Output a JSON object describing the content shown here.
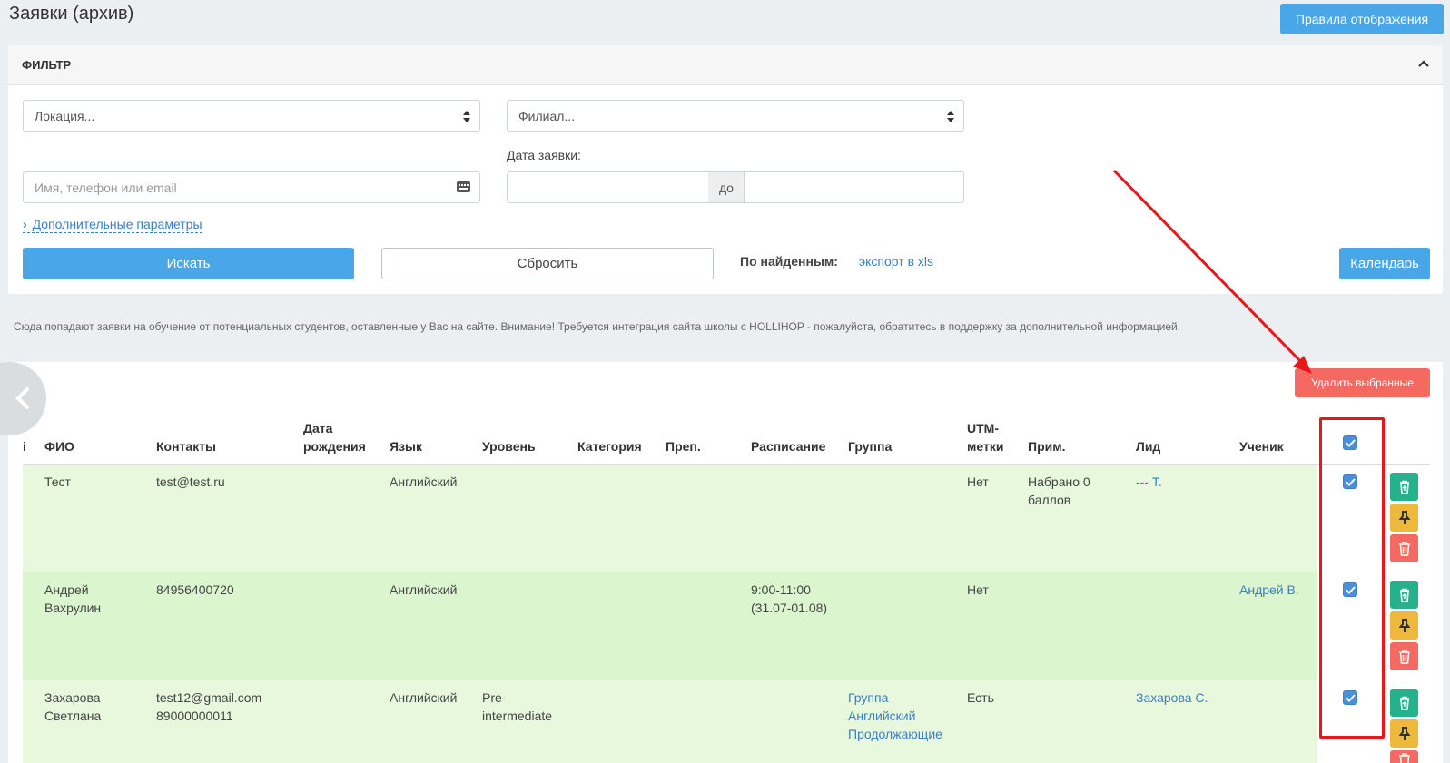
{
  "page": {
    "title": "Заявки (архив)"
  },
  "toolbar": {
    "rules_label": "Правила отображения"
  },
  "filter": {
    "title": "ФИЛЬТР",
    "location_select": "Локация...",
    "branch_select": "Филиал...",
    "search_placeholder": "Имя, телефон или email",
    "date_label": "Дата заявки:",
    "date_to_label": "до",
    "advanced_link": "Дополнительные параметры",
    "search_button": "Искать",
    "reset_button": "Сбросить",
    "found_label": "По найденным:",
    "export_link": "экспорт в xls",
    "calendar_button": "Календарь"
  },
  "info": {
    "text": "Сюда попадают заявки на обучение от потенциальных студентов, оставленные у Вас на сайте. Внимание! Требуется интеграция сайта школы с HOLLIHOP - пожалуйста, обратитесь в поддержку за дополнительной информацией."
  },
  "table": {
    "delete_selected": "Удалить выбранные",
    "headers": {
      "id": "і",
      "fio": "ФИО",
      "contacts": "Контакты",
      "birth_1": "Дата",
      "birth_2": "рождения",
      "language": "Язык",
      "level": "Уровень",
      "category": "Категория",
      "teacher": "Преп.",
      "schedule": "Расписание",
      "group": "Группа",
      "utm_1": "UTM-",
      "utm_2": "метки",
      "note": "Прим.",
      "lead": "Лид",
      "student": "Ученик"
    },
    "rows": [
      {
        "fio_1": "Тест",
        "fio_2": "",
        "contacts_1": "test@test.ru",
        "contacts_2": "",
        "language": "Английский",
        "level_1": "",
        "level_2": "",
        "schedule_1": "",
        "schedule_2": "",
        "group_1": "",
        "group_2": "",
        "group_3": "",
        "utm": "Нет",
        "note_1": "Набрано 0",
        "note_2": "баллов",
        "lead": "--- Т.",
        "student": "",
        "checked": true
      },
      {
        "fio_1": "Андрей",
        "fio_2": "Вахрулин",
        "contacts_1": "84956400720",
        "contacts_2": "",
        "language": "Английский",
        "level_1": "",
        "level_2": "",
        "schedule_1": "9:00-11:00",
        "schedule_2": "(31.07-01.08)",
        "group_1": "",
        "group_2": "",
        "group_3": "",
        "utm": "Нет",
        "note_1": "",
        "note_2": "",
        "lead": "",
        "student": "Андрей В.",
        "checked": true
      },
      {
        "fio_1": "Захарова",
        "fio_2": "Светлана",
        "contacts_1": "test12@gmail.com",
        "contacts_2": "89000000011",
        "language": "Английский",
        "level_1": "Pre-",
        "level_2": "intermediate",
        "schedule_1": "",
        "schedule_2": "",
        "group_1": "Группа",
        "group_2": "Английский",
        "group_3": "Продолжающие",
        "utm": "Есть",
        "note_1": "",
        "note_2": "",
        "lead": "Захарова С.",
        "student": "",
        "checked": true
      }
    ]
  },
  "colors": {
    "primary": "#49a7e8",
    "danger": "#f46a63",
    "success": "#26b18d",
    "warning": "#ecb93c",
    "row_green_light": "#e7f8dd",
    "row_green": "#dbf6cf",
    "annotation_red": "#e8181a"
  },
  "icons": [
    "chevron-up-icon",
    "sort-icon",
    "keyboard-icon",
    "chevron-right-icon",
    "chevron-left-icon",
    "check-icon",
    "restore-icon",
    "pin-icon",
    "trash-icon"
  ]
}
